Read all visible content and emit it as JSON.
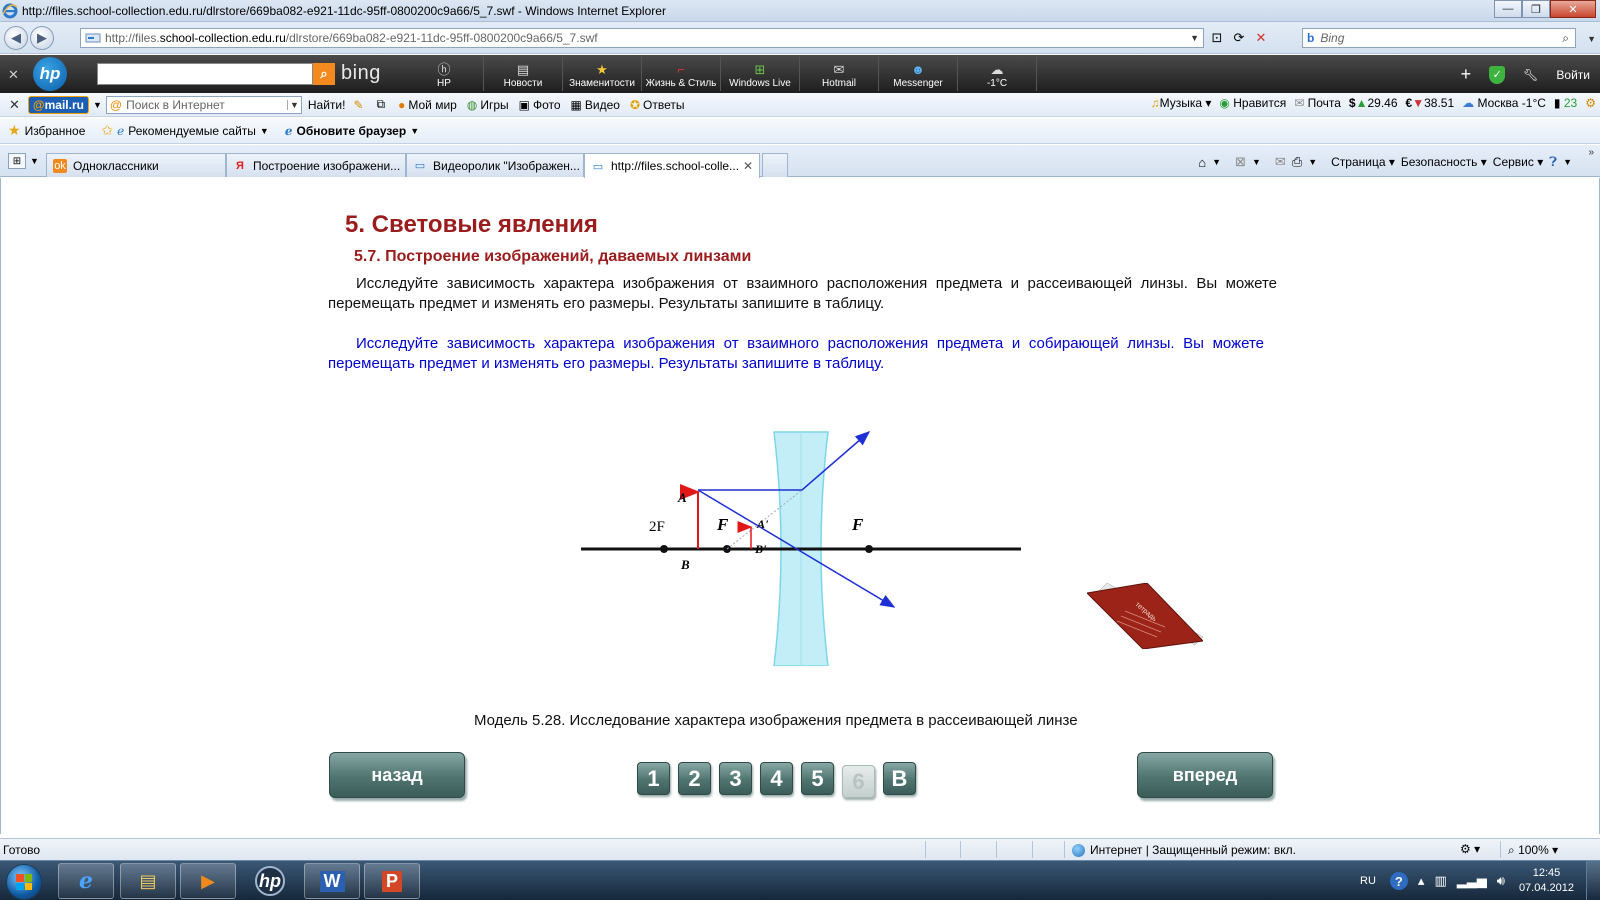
{
  "window": {
    "title": "http://files.school-collection.edu.ru/dlrstore/669ba082-e921-11dc-95ff-0800200c9a66/5_7.swf - Windows Internet Explorer"
  },
  "address": {
    "prefix": "http://files.",
    "domain": "school-collection.edu.ru",
    "path": "/dlrstore/669ba082-e921-11dc-95ff-0800200c9a66/5_7.swf",
    "search_placeholder": "Bing"
  },
  "hp_toolbar": {
    "bing_label": "bing",
    "items": [
      {
        "label": "HP",
        "icon": "hp-small-icon"
      },
      {
        "label": "Новости",
        "icon": "news-icon"
      },
      {
        "label": "Знаменитости",
        "icon": "star-icon"
      },
      {
        "label": "Жизнь & Стиль",
        "icon": "shoe-icon"
      },
      {
        "label": "Windows Live",
        "icon": "windows-icon"
      },
      {
        "label": "Hotmail",
        "icon": "mail-icon"
      },
      {
        "label": "Messenger",
        "icon": "messenger-icon"
      },
      {
        "label": "-1°C",
        "icon": "cloud-icon"
      }
    ],
    "signin_label": "Войти"
  },
  "mail_toolbar": {
    "logo": "@mail.ru",
    "search_placeholder": "Поиск в Интернет",
    "go_label": "Найти!",
    "items": [
      {
        "label": "Мой мир"
      },
      {
        "label": "Игры"
      },
      {
        "label": "Фото"
      },
      {
        "label": "Видео"
      },
      {
        "label": "Ответы"
      }
    ],
    "right": {
      "music": "Музыка",
      "like": "Нравится",
      "mail": "Почта",
      "usd": "29.46",
      "eur": "38.51",
      "weather": "Москва -1°C",
      "count": "23"
    }
  },
  "favorites_bar": {
    "favorites": "Избранное",
    "recommended": "Рекомендуемые сайты",
    "update": "Обновите браузер"
  },
  "tabs": [
    {
      "label": "Одноклассники"
    },
    {
      "label": "Построение изображени..."
    },
    {
      "label": "Видеоролик \"Изображен..."
    },
    {
      "label": "http://files.school-colle..."
    }
  ],
  "command_bar": {
    "page": "Страница",
    "safety": "Безопасность",
    "tools": "Сервис"
  },
  "content": {
    "heading": "5. Световые явления",
    "subheading": "5.7. Построение изображений, даваемых линзами",
    "paragraph1": "Исследуйте зависимость характера изображения от взаимного расположения предмета и рассеивающей линзы. Вы можете перемещать предмет и изменять его размеры. Результаты запишите в таблицу.",
    "paragraph2": "Исследуйте зависимость характера изображения от взаимного расположения предмета и собирающей линзы. Вы можете перемещать предмет и изменять его размеры. Результаты запишите в таблицу.",
    "diagram": {
      "label_2f": "2F",
      "label_f_left": "F",
      "label_f_right": "F",
      "label_a": "A",
      "label_b": "B",
      "label_a_img": "A'",
      "label_b_img": "B'"
    },
    "notebook_label": "тетрадь",
    "caption": "Модель 5.28. Исследование характера изображения предмета в рассеивающей линзе",
    "back_button": "назад",
    "forward_button": "вперед",
    "pages": [
      "1",
      "2",
      "3",
      "4",
      "5",
      "6",
      "В"
    ],
    "current_page": "6"
  },
  "statusbar": {
    "status": "Готово",
    "zone": "Интернет | Защищенный режим: вкл.",
    "zoom": "100%"
  },
  "taskbar": {
    "language": "RU",
    "time": "12:45",
    "date": "07.04.2012"
  }
}
